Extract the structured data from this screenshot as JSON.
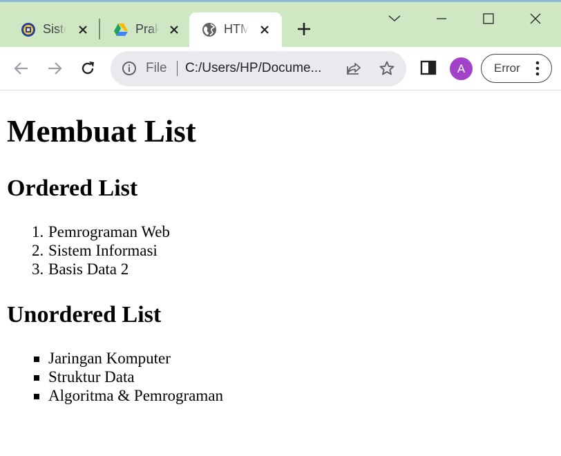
{
  "browser": {
    "tabs": [
      {
        "title": "Sistem",
        "favicon": "university-seal-icon",
        "active": false
      },
      {
        "title": "Praktikum",
        "favicon": "google-drive-icon",
        "active": false
      },
      {
        "title": "HTML",
        "favicon": "globe-icon",
        "active": true
      }
    ],
    "window_controls": [
      "tab-search-chevron-icon",
      "minimize-icon",
      "maximize-icon",
      "close-icon"
    ],
    "address_bar": {
      "scheme_label": "File",
      "url": "C:/Users/HP/Docume..."
    },
    "avatar_letter": "A",
    "error_label": "Error",
    "colors": {
      "tabstrip": "#cfe8c3",
      "avatar": "#a142c8",
      "drive_green": "#1ea362",
      "drive_yellow": "#ffba00",
      "drive_blue": "#4285f4"
    }
  },
  "page": {
    "heading": "Membuat List",
    "ordered": {
      "heading": "Ordered List",
      "numbers": [
        "1.",
        "2.",
        "3."
      ],
      "items": [
        "Pemrograman Web",
        "Sistem Informasi",
        "Basis Data 2"
      ]
    },
    "unordered": {
      "heading": "Unordered List",
      "items": [
        "Jaringan Komputer",
        "Struktur Data",
        "Algoritma & Pemrograman"
      ]
    }
  }
}
